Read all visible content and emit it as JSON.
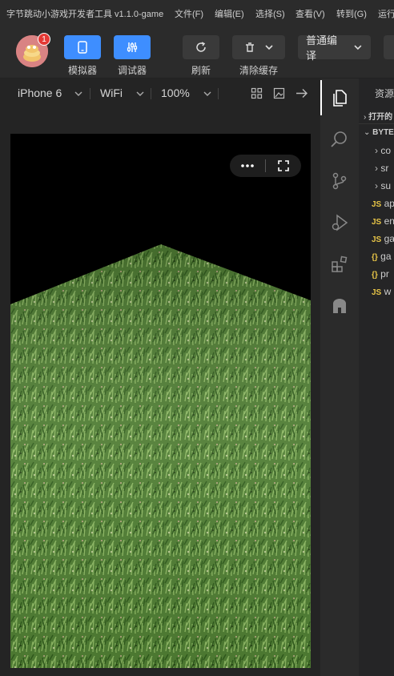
{
  "title_bar": {
    "app_title": "字节跳动小游戏开发者工具 v1.1.0-game",
    "menu": [
      "文件(F)",
      "编辑(E)",
      "选择(S)",
      "查看(V)",
      "转到(G)",
      "运行"
    ]
  },
  "toolbar": {
    "notification_count": "1",
    "simulator_label": "模拟器",
    "debugger_label": "调试器",
    "refresh_label": "刷新",
    "clear_cache_label": "清除缓存",
    "compile_mode": "普通编译"
  },
  "sim_toolbar": {
    "device": "iPhone 6",
    "network": "WiFi",
    "zoom": "100%"
  },
  "explorer": {
    "header": "资源管",
    "open_editors": "打开的",
    "project": "BYTE",
    "folders": [
      "co",
      "sr",
      "su"
    ],
    "files": [
      {
        "type": "JS",
        "name": "ap"
      },
      {
        "type": "JS",
        "name": "en"
      },
      {
        "type": "JS",
        "name": "ga"
      },
      {
        "type": "{}",
        "name": "ga"
      },
      {
        "type": "{}",
        "name": "pr"
      },
      {
        "type": "JS",
        "name": "w"
      }
    ]
  },
  "colors": {
    "accent_blue": "#3e8eff",
    "badge_red": "#e53935",
    "grass_dark": "#3d6b28",
    "grass_light": "#7fa855"
  }
}
